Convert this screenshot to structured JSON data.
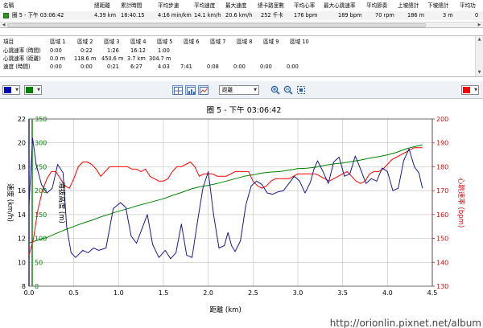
{
  "summary": {
    "headers": [
      "名稱",
      "總距離",
      "累計時間",
      "平均步速",
      "平均速度",
      "最大速度",
      "總卡路里數",
      "平均心率",
      "最大心跳速率",
      "平均節奏",
      "上坡總計",
      "下坡總計",
      "平均功"
    ],
    "row": [
      "圈 5 - 下午 03:06:42",
      "4.39 km",
      "18:40.15",
      "4:16 min/km",
      "14.1 km/h",
      "20.6 km/h",
      "252 千卡",
      "176 bpm",
      "189 bpm",
      "70 rpm",
      "186 m",
      "3 m",
      "0"
    ]
  },
  "zones": {
    "headers": [
      "項目",
      "區域 1",
      "區域 2",
      "區域 3",
      "區域 4",
      "區域 5",
      "區域 6",
      "區域 7",
      "區域 8",
      "區域 9",
      "區域 10"
    ],
    "rows": [
      [
        "心跳速率 (時間)",
        "0:00",
        "0:22",
        "1:26",
        "16:12",
        "1:00",
        "",
        "",
        "",
        "",
        ""
      ],
      [
        "心跳速率 (距離)",
        "0.0 m",
        "118.6 m",
        "450.6 m",
        "3.7 km",
        "304.7 m",
        "",
        "",
        "",
        "",
        ""
      ],
      [
        "速度 (時間)",
        "0:00",
        "0:00",
        "0:21",
        "6:27",
        "4:03",
        "7:41",
        "0:08",
        "0:00",
        "0:00",
        "0:00"
      ]
    ]
  },
  "toolbar": {
    "left_color_1": "#0000c0",
    "left_color_2": "#008000",
    "right_color": "#ff0000",
    "distance_mode": "距離"
  },
  "chart_data": {
    "type": "line",
    "title": "圈 5 - 下午 03:06:42",
    "xlabel": "距離 (km)",
    "xlim": [
      0,
      4.5
    ],
    "xticks": [
      "0.0",
      "0.5",
      "1.0",
      "1.5",
      "2.0",
      "2.5",
      "3.0",
      "3.5",
      "4.0",
      "4.5"
    ],
    "grid": true,
    "axes": {
      "speed": {
        "label": "速度 (km/h)",
        "color": "#000000",
        "ylim": [
          8,
          22
        ],
        "ticks": [
          "8",
          "10",
          "12",
          "14",
          "16",
          "18",
          "20",
          "22"
        ]
      },
      "elevation": {
        "label": "海拔高度 (m)",
        "color": "#008000",
        "ylim": [
          0,
          350
        ],
        "ticks": [
          "0",
          "50",
          "100",
          "150",
          "200",
          "250",
          "300",
          "350"
        ]
      },
      "heart_rate": {
        "label": "心跳速率 (bpm)",
        "color": "#ff0000",
        "ylim": [
          130,
          200
        ],
        "ticks": [
          "130",
          "140",
          "150",
          "160",
          "170",
          "180",
          "190",
          "200"
        ]
      }
    },
    "series": [
      {
        "axis": "speed",
        "color": "#1a1a8c",
        "x": [
          0.0,
          0.04,
          0.08,
          0.14,
          0.2,
          0.26,
          0.32,
          0.38,
          0.42,
          0.47,
          0.52,
          0.6,
          0.66,
          0.72,
          0.78,
          0.86,
          0.94,
          1.02,
          1.08,
          1.14,
          1.2,
          1.26,
          1.32,
          1.38,
          1.45,
          1.52,
          1.58,
          1.64,
          1.7,
          1.76,
          1.82,
          1.88,
          1.94,
          2.0,
          2.06,
          2.12,
          2.18,
          2.22,
          2.26,
          2.3,
          2.36,
          2.42,
          2.48,
          2.54,
          2.6,
          2.66,
          2.72,
          2.78,
          2.84,
          2.9,
          2.96,
          3.02,
          3.08,
          3.14,
          3.18,
          3.22,
          3.28,
          3.34,
          3.4,
          3.46,
          3.52,
          3.58,
          3.64,
          3.7,
          3.76,
          3.82,
          3.88,
          3.94,
          4.0,
          4.06,
          4.12,
          4.18,
          4.24,
          4.3,
          4.35,
          4.39
        ],
        "y": [
          14.8,
          20.4,
          18.2,
          16.5,
          15.8,
          16.2,
          18.2,
          17.5,
          13.0,
          10.8,
          10.4,
          11.0,
          10.8,
          11.2,
          11.0,
          11.2,
          14.5,
          15.0,
          14.6,
          12.2,
          11.6,
          12.8,
          14.0,
          11.5,
          10.4,
          11.0,
          10.3,
          10.8,
          13.2,
          10.6,
          10.4,
          13.4,
          16.2,
          17.6,
          14.0,
          11.2,
          11.4,
          12.5,
          11.4,
          10.9,
          11.8,
          14.8,
          16.4,
          16.8,
          16.5,
          15.8,
          15.7,
          15.9,
          16.0,
          16.6,
          17.2,
          16.8,
          15.8,
          16.7,
          17.8,
          18.5,
          17.6,
          16.6,
          18.4,
          18.8,
          17.2,
          17.4,
          18.9,
          17.8,
          16.6,
          17.0,
          16.8,
          17.9,
          17.6,
          16.0,
          16.2,
          18.5,
          19.5,
          18.0,
          17.5,
          16.2
        ]
      },
      {
        "axis": "elevation",
        "color": "#008000",
        "x": [
          0.0,
          0.1,
          0.2,
          0.3,
          0.4,
          0.5,
          0.6,
          0.7,
          0.8,
          0.9,
          1.0,
          1.1,
          1.2,
          1.3,
          1.4,
          1.5,
          1.6,
          1.7,
          1.8,
          1.9,
          2.0,
          2.1,
          2.2,
          2.3,
          2.4,
          2.5,
          2.6,
          2.7,
          2.8,
          2.9,
          3.0,
          3.1,
          3.2,
          3.3,
          3.4,
          3.5,
          3.6,
          3.7,
          3.8,
          3.9,
          4.0,
          4.1,
          4.2,
          4.3,
          4.39
        ],
        "y": [
          90,
          97,
          102,
          110,
          118,
          125,
          132,
          138,
          145,
          151,
          157,
          162,
          168,
          173,
          178,
          183,
          190,
          196,
          203,
          208,
          211,
          215,
          220,
          225,
          230,
          233,
          237,
          239,
          240,
          243,
          246,
          247,
          249,
          253,
          256,
          258,
          261,
          264,
          268,
          271,
          275,
          280,
          287,
          292,
          296
        ]
      },
      {
        "axis": "heart_rate",
        "color": "#ff0000",
        "x": [
          0.0,
          0.05,
          0.1,
          0.15,
          0.2,
          0.25,
          0.3,
          0.35,
          0.4,
          0.45,
          0.5,
          0.55,
          0.6,
          0.65,
          0.7,
          0.75,
          0.8,
          0.85,
          0.9,
          0.95,
          1.0,
          1.05,
          1.1,
          1.15,
          1.2,
          1.25,
          1.3,
          1.35,
          1.4,
          1.45,
          1.5,
          1.55,
          1.6,
          1.65,
          1.7,
          1.75,
          1.8,
          1.85,
          1.9,
          1.95,
          2.0,
          2.05,
          2.1,
          2.15,
          2.2,
          2.25,
          2.3,
          2.35,
          2.4,
          2.45,
          2.5,
          2.55,
          2.6,
          2.65,
          2.7,
          2.75,
          2.8,
          2.85,
          2.9,
          2.95,
          3.0,
          3.05,
          3.1,
          3.15,
          3.2,
          3.25,
          3.3,
          3.35,
          3.4,
          3.45,
          3.5,
          3.55,
          3.6,
          3.65,
          3.7,
          3.75,
          3.8,
          3.85,
          3.9,
          3.95,
          4.0,
          4.05,
          4.1,
          4.15,
          4.2,
          4.25,
          4.3,
          4.35,
          4.39
        ],
        "y": [
          143,
          150,
          162,
          170,
          175,
          178,
          178,
          175,
          172,
          171,
          175,
          180,
          182,
          182,
          181,
          179,
          176,
          178,
          180,
          180,
          180,
          180,
          180,
          179,
          179,
          178,
          179,
          176,
          175,
          174,
          174,
          175,
          178,
          180,
          180,
          181,
          182,
          180,
          176,
          177,
          177,
          177,
          176,
          176,
          176,
          177,
          178,
          178,
          178,
          178,
          174,
          172,
          171,
          172,
          174,
          175,
          175,
          175,
          175,
          176,
          177,
          177,
          177,
          177,
          177,
          176,
          175,
          174,
          175,
          176,
          177,
          178,
          176,
          174,
          173,
          174,
          177,
          178,
          178,
          179,
          181,
          183,
          184,
          185,
          186,
          187,
          188,
          188,
          188
        ]
      }
    ]
  },
  "watermark": "http://orionlin.pixnet.net/album"
}
